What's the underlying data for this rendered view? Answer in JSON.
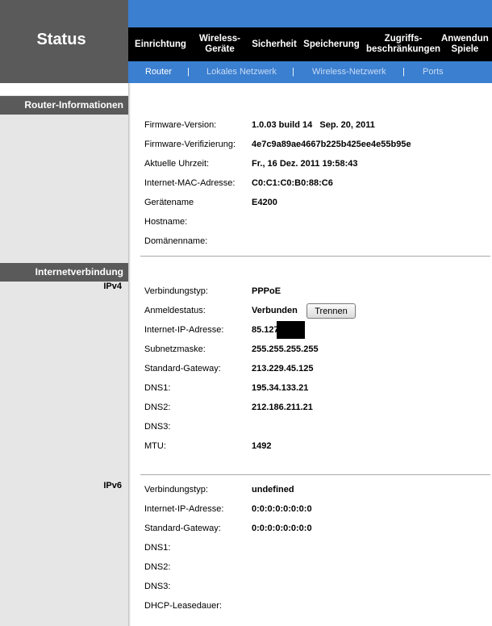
{
  "sidebar": {
    "title": "Status",
    "sections": [
      {
        "label": "Router-Informationen"
      },
      {
        "label": "Internetverbindung"
      }
    ],
    "sublabels": {
      "ipv4": "IPv4",
      "ipv6": "IPv6"
    }
  },
  "nav": {
    "items": [
      {
        "label": "Einrichtung"
      },
      {
        "label": "Wireless-\nGeräte"
      },
      {
        "label": "Sicherheit"
      },
      {
        "label": "Speicherung"
      },
      {
        "label": "Zugriffs-\nbeschränkungen"
      },
      {
        "label": "Anwendun\nSpiele"
      }
    ],
    "subitems": [
      {
        "label": "Router",
        "active": true
      },
      {
        "label": "Lokales Netzwerk",
        "active": false
      },
      {
        "label": "Wireless-Netzwerk",
        "active": false
      },
      {
        "label": "Ports",
        "active": false
      }
    ],
    "separator": "|"
  },
  "router_info": [
    {
      "label": "Firmware-Version:",
      "value": "1.0.03 build 14   Sep. 20, 2011"
    },
    {
      "label": "Firmware-Verifizierung:",
      "value": "4e7c9a89ae4667b225b425ee4e55b95e"
    },
    {
      "label": "Aktuelle Uhrzeit:",
      "value": "Fr., 16 Dez. 2011 19:58:43"
    },
    {
      "label": "Internet-MAC-Adresse:",
      "value": "C0:C1:C0:B0:88:C6"
    },
    {
      "label": "Gerätename",
      "value": "E4200"
    },
    {
      "label": "Hostname:",
      "value": ""
    },
    {
      "label": "Domänenname:",
      "value": ""
    }
  ],
  "ipv4": [
    {
      "label": "Verbindungstyp:",
      "value": "PPPoE"
    },
    {
      "label": "Anmeldestatus:",
      "value": "Verbunden"
    },
    {
      "label": "Internet-IP-Adresse:",
      "value": "85.127"
    },
    {
      "label": "Subnetzmaske:",
      "value": "255.255.255.255"
    },
    {
      "label": "Standard-Gateway:",
      "value": "213.229.45.125"
    },
    {
      "label": "DNS1:",
      "value": "195.34.133.21"
    },
    {
      "label": "DNS2:",
      "value": "212.186.211.21"
    },
    {
      "label": "DNS3:",
      "value": ""
    },
    {
      "label": "MTU:",
      "value": "1492"
    }
  ],
  "disconnect_button": "Trennen",
  "ipv6": [
    {
      "label": "Verbindungstyp:",
      "value": "undefined"
    },
    {
      "label": "Internet-IP-Adresse:",
      "value": "0:0:0:0:0:0:0:0"
    },
    {
      "label": "Standard-Gateway:",
      "value": "0:0:0:0:0:0:0:0"
    },
    {
      "label": "DNS1:",
      "value": ""
    },
    {
      "label": "DNS2:",
      "value": ""
    },
    {
      "label": "DNS3:",
      "value": ""
    },
    {
      "label": "DHCP-Leasedauer:",
      "value": ""
    }
  ],
  "colors": {
    "brand_blue": "#3b7fd0",
    "nav_black": "#000000",
    "sidebar_gray": "#5a5a5a",
    "leftcol_gray": "#e6e6e6",
    "active_subnav": "#ffffff",
    "inactive_subnav": "#c9dcf5"
  }
}
